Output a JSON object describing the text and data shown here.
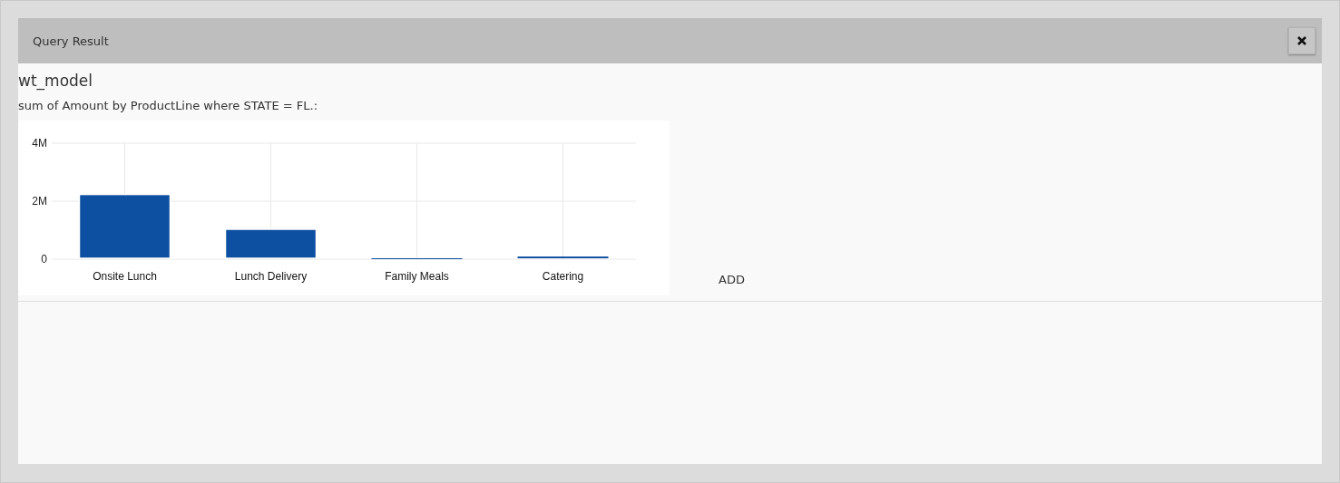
{
  "dialog": {
    "title": "Query Result"
  },
  "model": "wt_model",
  "description": "sum of Amount by ProductLine where STATE = FL.:",
  "chart_data": {
    "type": "bar",
    "categories": [
      "Onsite Lunch",
      "Lunch Delivery",
      "Family Meals",
      "Catering"
    ],
    "series": [
      {
        "color": "#0d4fa0",
        "values": [
          2200000,
          1000000,
          0,
          60000
        ]
      }
    ],
    "grid": true,
    "ylim": [
      0,
      4000000
    ],
    "yticks": [
      {
        "value": 0,
        "label": "0"
      },
      {
        "value": 2000000,
        "label": "2M"
      },
      {
        "value": 4000000,
        "label": "4M"
      }
    ]
  },
  "add_label": "ADD"
}
